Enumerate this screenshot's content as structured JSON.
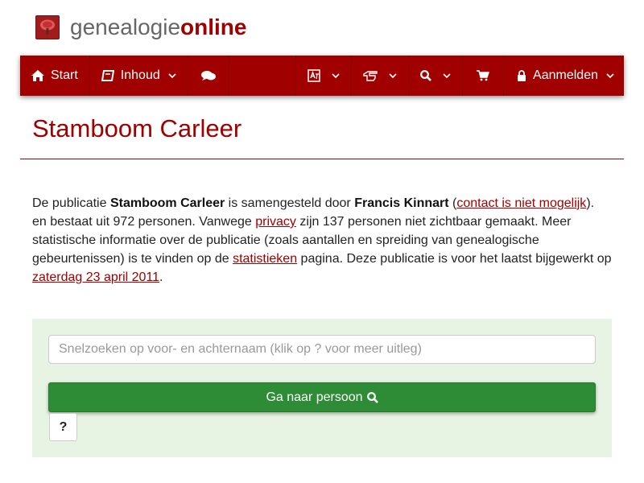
{
  "logo": {
    "text_light": "genealogie",
    "text_bold": "online",
    "icon": "tree-icon"
  },
  "nav": {
    "start_label": "Start",
    "inhoud_label": "Inhoud",
    "aanmelden_label": "Aanmelden",
    "icons": [
      "home-icon",
      "book-icon",
      "comments-icon",
      "language-icon",
      "hand-pointer-icon",
      "search-icon",
      "cart-icon",
      "lock-icon"
    ]
  },
  "page": {
    "title": "Stamboom Carleer"
  },
  "intro": {
    "p1": "De publicatie ",
    "publication": "Stamboom Carleer",
    "p2": " is samengesteld door ",
    "author": "Francis Kinnart",
    "p3": " (",
    "contact_link": "contact is niet mogelijk",
    "p4": ").",
    "p5": "en bestaat uit 972 personen. Vanwege ",
    "privacy_link": "privacy",
    "p6": " zijn 137 personen niet zichtbaar gemaakt. Meer statistische informatie over de publicatie (zoals aantallen en spreiding van genealogische gebeurtenissen) is te vinden op de ",
    "stats_link": "statistieken",
    "p7": " pagina. Deze publicatie is voor het laatst bijgewerkt op ",
    "date_link": "zaterdag 23 april 2011",
    "p8": "."
  },
  "search": {
    "placeholder": "Snelzoeken op voor- en achternaam (klik op ? voor meer uitleg)",
    "go_label": "Ga naar persoon",
    "help_label": "?"
  },
  "colors": {
    "brand": "#a00000",
    "panel": "#e7f4e3",
    "button": "#2e8b36"
  }
}
